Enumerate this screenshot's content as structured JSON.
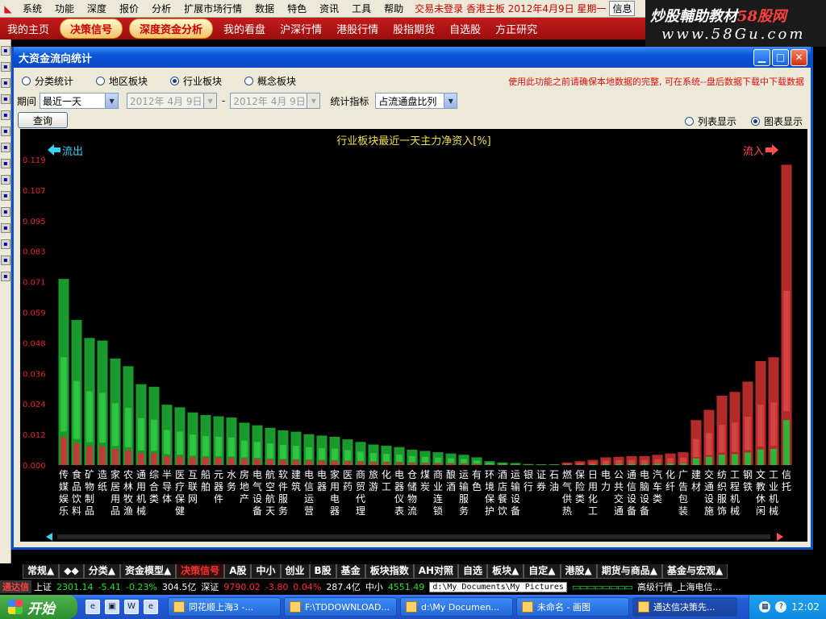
{
  "menubar": {
    "items": [
      "系统",
      "功能",
      "深度",
      "报价",
      "分析",
      "扩展市场行情",
      "数据",
      "特色",
      "资讯",
      "工具",
      "帮助"
    ],
    "status": "交易未登录 香港主板 2012年4月9日 星期一",
    "info_label": "信息"
  },
  "navbar": {
    "items": [
      "我的主页",
      "决策信号",
      "深度资金分析",
      "我的看盘",
      "沪深行情",
      "港股行情",
      "股指期货",
      "自选股",
      "方正研究"
    ]
  },
  "watermark": {
    "line1_a": "炒股輔助教材",
    "line1_b": "58股网",
    "line2": "www.58Gu.com"
  },
  "dialog": {
    "title": "大资金流向统计",
    "radios": [
      "分类统计",
      "地区板块",
      "行业板块",
      "概念板块"
    ],
    "radio_selected": 2,
    "warning": "使用此功能之前请确保本地数据的完整, 可在系统--盘后数据下载中下载数据",
    "period_label": "期间",
    "period_value": "最近一天",
    "date_from": "2012年 4月 9日",
    "date_sep": "-",
    "date_to": "2012年 4月 9日",
    "indicator_label": "统计指标",
    "indicator_value": "占流通盘比列",
    "query_label": "查询",
    "view_options": [
      "列表显示",
      "图表显示"
    ],
    "view_selected": 1
  },
  "chart_data": {
    "type": "bar",
    "title": "行业板块最近一天主力净资入[%]",
    "left_label": "流出",
    "right_label": "流入",
    "ylim": [
      0,
      0.119
    ],
    "yticks": [
      "0.119",
      "0.107",
      "0.095",
      "0.083",
      "0.071",
      "0.059",
      "0.048",
      "0.036",
      "0.024",
      "0.012",
      "0.000"
    ],
    "categories": [
      "传媒娱乐",
      "食品饮料",
      "矿物制品",
      "造纸",
      "家居用品",
      "农林牧渔",
      "通用机械",
      "综合类",
      "半导体",
      "医疗保健",
      "互联网",
      "船舶",
      "元器件",
      "水务",
      "房地产",
      "电气设备",
      "航空航天",
      "软件服务",
      "建筑",
      "电信运营",
      "电器",
      "家用电器",
      "医药",
      "商贸代理",
      "旅游",
      "化工",
      "电器仪表",
      "仓储物流",
      "煤炭",
      "商业连锁",
      "酿酒",
      "运输服务",
      "有色",
      "环境保护",
      "酒店餐饮",
      "运输设备",
      "银行",
      "证券",
      "石油",
      "燃气供热",
      "保险类",
      "日用化工",
      "电力",
      "公共交通",
      "通信设备",
      "电脑设备",
      "汽车类",
      "化纤",
      "广告包装",
      "建材",
      "交通设施",
      "纺织服饰",
      "工程机械",
      "钢铁",
      "文教休闲",
      "工业机械",
      "信托"
    ],
    "direction": [
      "out",
      "out",
      "out",
      "out",
      "out",
      "out",
      "out",
      "out",
      "out",
      "out",
      "out",
      "out",
      "out",
      "out",
      "out",
      "out",
      "out",
      "out",
      "out",
      "out",
      "out",
      "out",
      "out",
      "out",
      "out",
      "out",
      "out",
      "out",
      "out",
      "out",
      "out",
      "out",
      "out",
      "out",
      "out",
      "out",
      "out",
      "out",
      "out",
      "in",
      "in",
      "in",
      "in",
      "in",
      "in",
      "in",
      "in",
      "in",
      "in",
      "in",
      "in",
      "in",
      "in",
      "in",
      "in",
      "in",
      "in"
    ],
    "values": [
      0.0725,
      0.0565,
      0.0495,
      0.0485,
      0.0415,
      0.0385,
      0.0315,
      0.0305,
      0.0235,
      0.0225,
      0.0205,
      0.0195,
      0.019,
      0.0185,
      0.0165,
      0.0155,
      0.0145,
      0.0135,
      0.013,
      0.012,
      0.0115,
      0.011,
      0.01,
      0.009,
      0.008,
      0.0075,
      0.007,
      0.006,
      0.0055,
      0.005,
      0.0045,
      0.004,
      0.003,
      0.0015,
      0.001,
      0.0008,
      0.0004,
      0.0003,
      0.0003,
      0.001,
      0.0015,
      0.002,
      0.003,
      0.0032,
      0.0035,
      0.0035,
      0.004,
      0.0045,
      0.005,
      0.0175,
      0.0215,
      0.027,
      0.0285,
      0.0325,
      0.0405,
      0.042,
      0.117
    ]
  },
  "tabs": [
    "常规▲",
    "◆◆",
    "分类▲",
    "资金模型▲",
    "决策信号",
    "A股",
    "中小",
    "创业",
    "B股",
    "基金",
    "板块指数",
    "AH对照",
    "自选",
    "板块▲",
    "自定▲",
    "港股▲",
    "期货与商品▲",
    "基金与宏观▲"
  ],
  "tabs_active": 4,
  "ticker": {
    "brand": "通达信",
    "sh_label": "上证",
    "sh_value": "2301.14",
    "sh_change": "-5.41",
    "sh_pct": "-0.23%",
    "sh_amount": "304.5亿",
    "sz_label": "深证",
    "sz_value": "9790.02",
    "sz_change": "-3.80",
    "sz_pct": "0.04%",
    "sz_amount": "287.4亿",
    "zx_label": "中小",
    "zx_value": "4551.49",
    "path": "d:\\My Documents\\My Pictures",
    "right_text": "高级行情_上海电信..."
  },
  "taskbar": {
    "start_label": "开始",
    "quick_icons": [
      "ie-icon",
      "explorer-icon",
      "word-icon",
      "ie-icon2"
    ],
    "tasks": [
      "同花顺上海3 -...",
      "F:\\TDDOWNLOAD...",
      "d:\\My Documen...",
      "未命名 - 画图",
      "通达信决策先..."
    ],
    "active_task": 4,
    "time": "12:02"
  },
  "colors": {
    "out_fill": "#1a9a2e",
    "out_highlight": "#36d24a",
    "out_low": "#c23a3a",
    "in_fill": "#b22a2a",
    "in_highlight": "#e04b4b",
    "in_low": "#2db43a",
    "tick_color": "#e0282e",
    "title_color": "#f0e04a",
    "left_arrow": "#3ad0f0",
    "right_arrow": "#ff5050"
  }
}
